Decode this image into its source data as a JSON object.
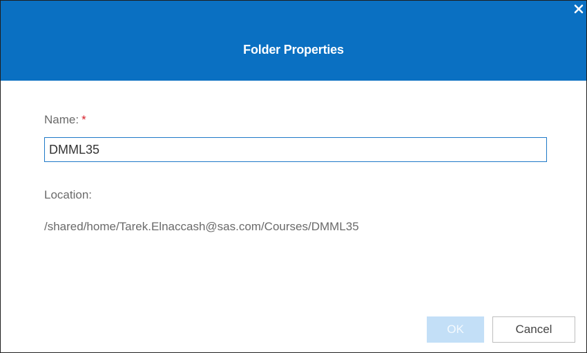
{
  "dialog": {
    "title": "Folder Properties",
    "close_icon": "close-icon",
    "name_label": "Name:",
    "required_marker": "*",
    "name_value": "DMML35",
    "location_label": "Location:",
    "location_value": "/shared/home/Tarek.Elnaccash@sas.com/Courses/DMML35",
    "ok_label": "OK",
    "cancel_label": "Cancel"
  },
  "colors": {
    "titlebar": "#0a70c2",
    "required": "#d6202b",
    "input_border": "#1d78c7",
    "ok_disabled": "#c3dff7"
  }
}
